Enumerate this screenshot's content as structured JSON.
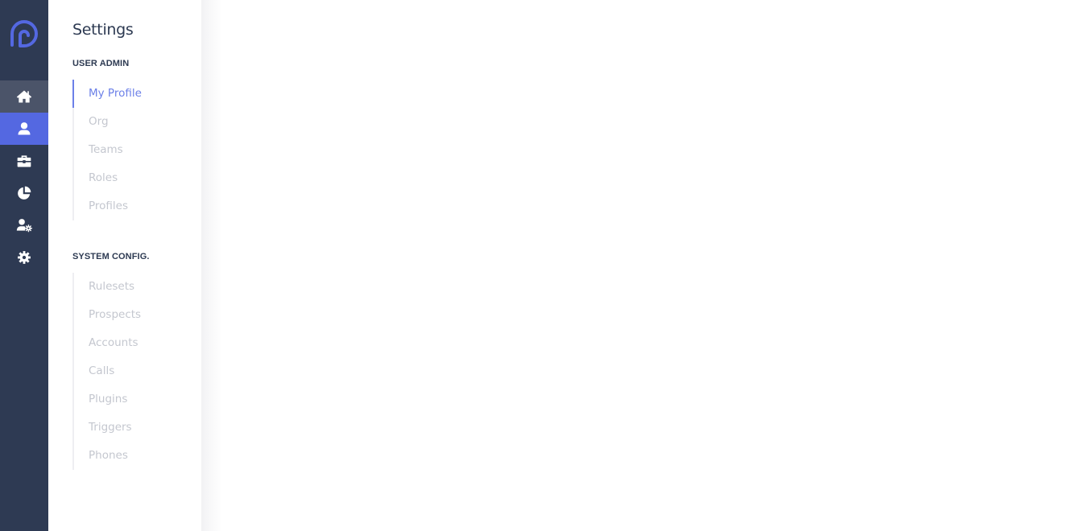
{
  "app": {
    "logo": "brand-logo",
    "accent_color": "#5468e1",
    "rail_color": "#2e3a53"
  },
  "rail": {
    "items": [
      {
        "name": "home",
        "icon": "home-icon",
        "state": "hover"
      },
      {
        "name": "user",
        "icon": "user-icon",
        "state": "active"
      },
      {
        "name": "briefcase",
        "icon": "briefcase-icon",
        "state": ""
      },
      {
        "name": "reports",
        "icon": "pie-chart-icon",
        "state": ""
      },
      {
        "name": "user-settings",
        "icon": "user-cog-icon",
        "state": ""
      },
      {
        "name": "settings",
        "icon": "gear-icon",
        "state": ""
      }
    ]
  },
  "settings": {
    "title": "Settings",
    "sections": [
      {
        "label": "USER ADMIN",
        "items": [
          {
            "label": "My Profile",
            "active": true
          },
          {
            "label": "Org"
          },
          {
            "label": "Teams"
          },
          {
            "label": "Roles"
          },
          {
            "label": "Profiles"
          }
        ]
      },
      {
        "label": "SYSTEM CONFIG.",
        "items": [
          {
            "label": "Rulesets"
          },
          {
            "label": "Prospects"
          },
          {
            "label": "Accounts"
          },
          {
            "label": "Calls"
          },
          {
            "label": "Plugins"
          },
          {
            "label": "Triggers"
          },
          {
            "label": "Phones"
          }
        ]
      }
    ]
  }
}
